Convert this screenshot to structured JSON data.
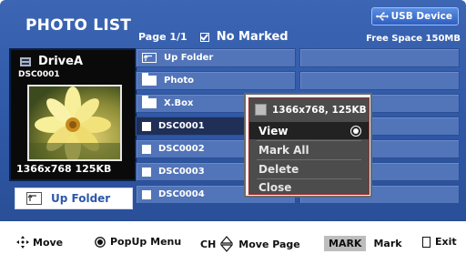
{
  "header": {
    "title": "PHOTO LIST",
    "page": "Page 1/1",
    "marked": "No Marked",
    "usb_label": "USB Device",
    "free_space": "Free Space 150MB"
  },
  "preview": {
    "drive": "DriveA",
    "filename": "DSC0001",
    "resolution": "1366x768  125KB",
    "up_folder_label": "Up Folder"
  },
  "file_list": {
    "items": [
      {
        "label": "Up Folder",
        "type": "up"
      },
      {
        "label": "Photo",
        "type": "folder"
      },
      {
        "label": "X.Box",
        "type": "folder"
      },
      {
        "label": "DSC0001",
        "type": "file"
      },
      {
        "label": "DSC0002",
        "type": "file"
      },
      {
        "label": "DSC0003",
        "type": "file"
      },
      {
        "label": "DSC0004",
        "type": "file"
      }
    ]
  },
  "popup": {
    "info": "1366x768, 125KB",
    "items": [
      {
        "label": "View",
        "selected": true
      },
      {
        "label": "Mark All"
      },
      {
        "label": "Delete"
      },
      {
        "label": "Close"
      }
    ]
  },
  "hints": {
    "move": "Move",
    "popup_menu": "PopUp Menu",
    "ch": "CH",
    "move_page": "Move Page",
    "mark_key": "MARK",
    "mark": "Mark",
    "exit": "Exit"
  },
  "colors": {
    "background": "#2f58a6",
    "cell": "#5274b8",
    "selected_cell": "#1f2f57",
    "popup": "#4c4c4c"
  }
}
